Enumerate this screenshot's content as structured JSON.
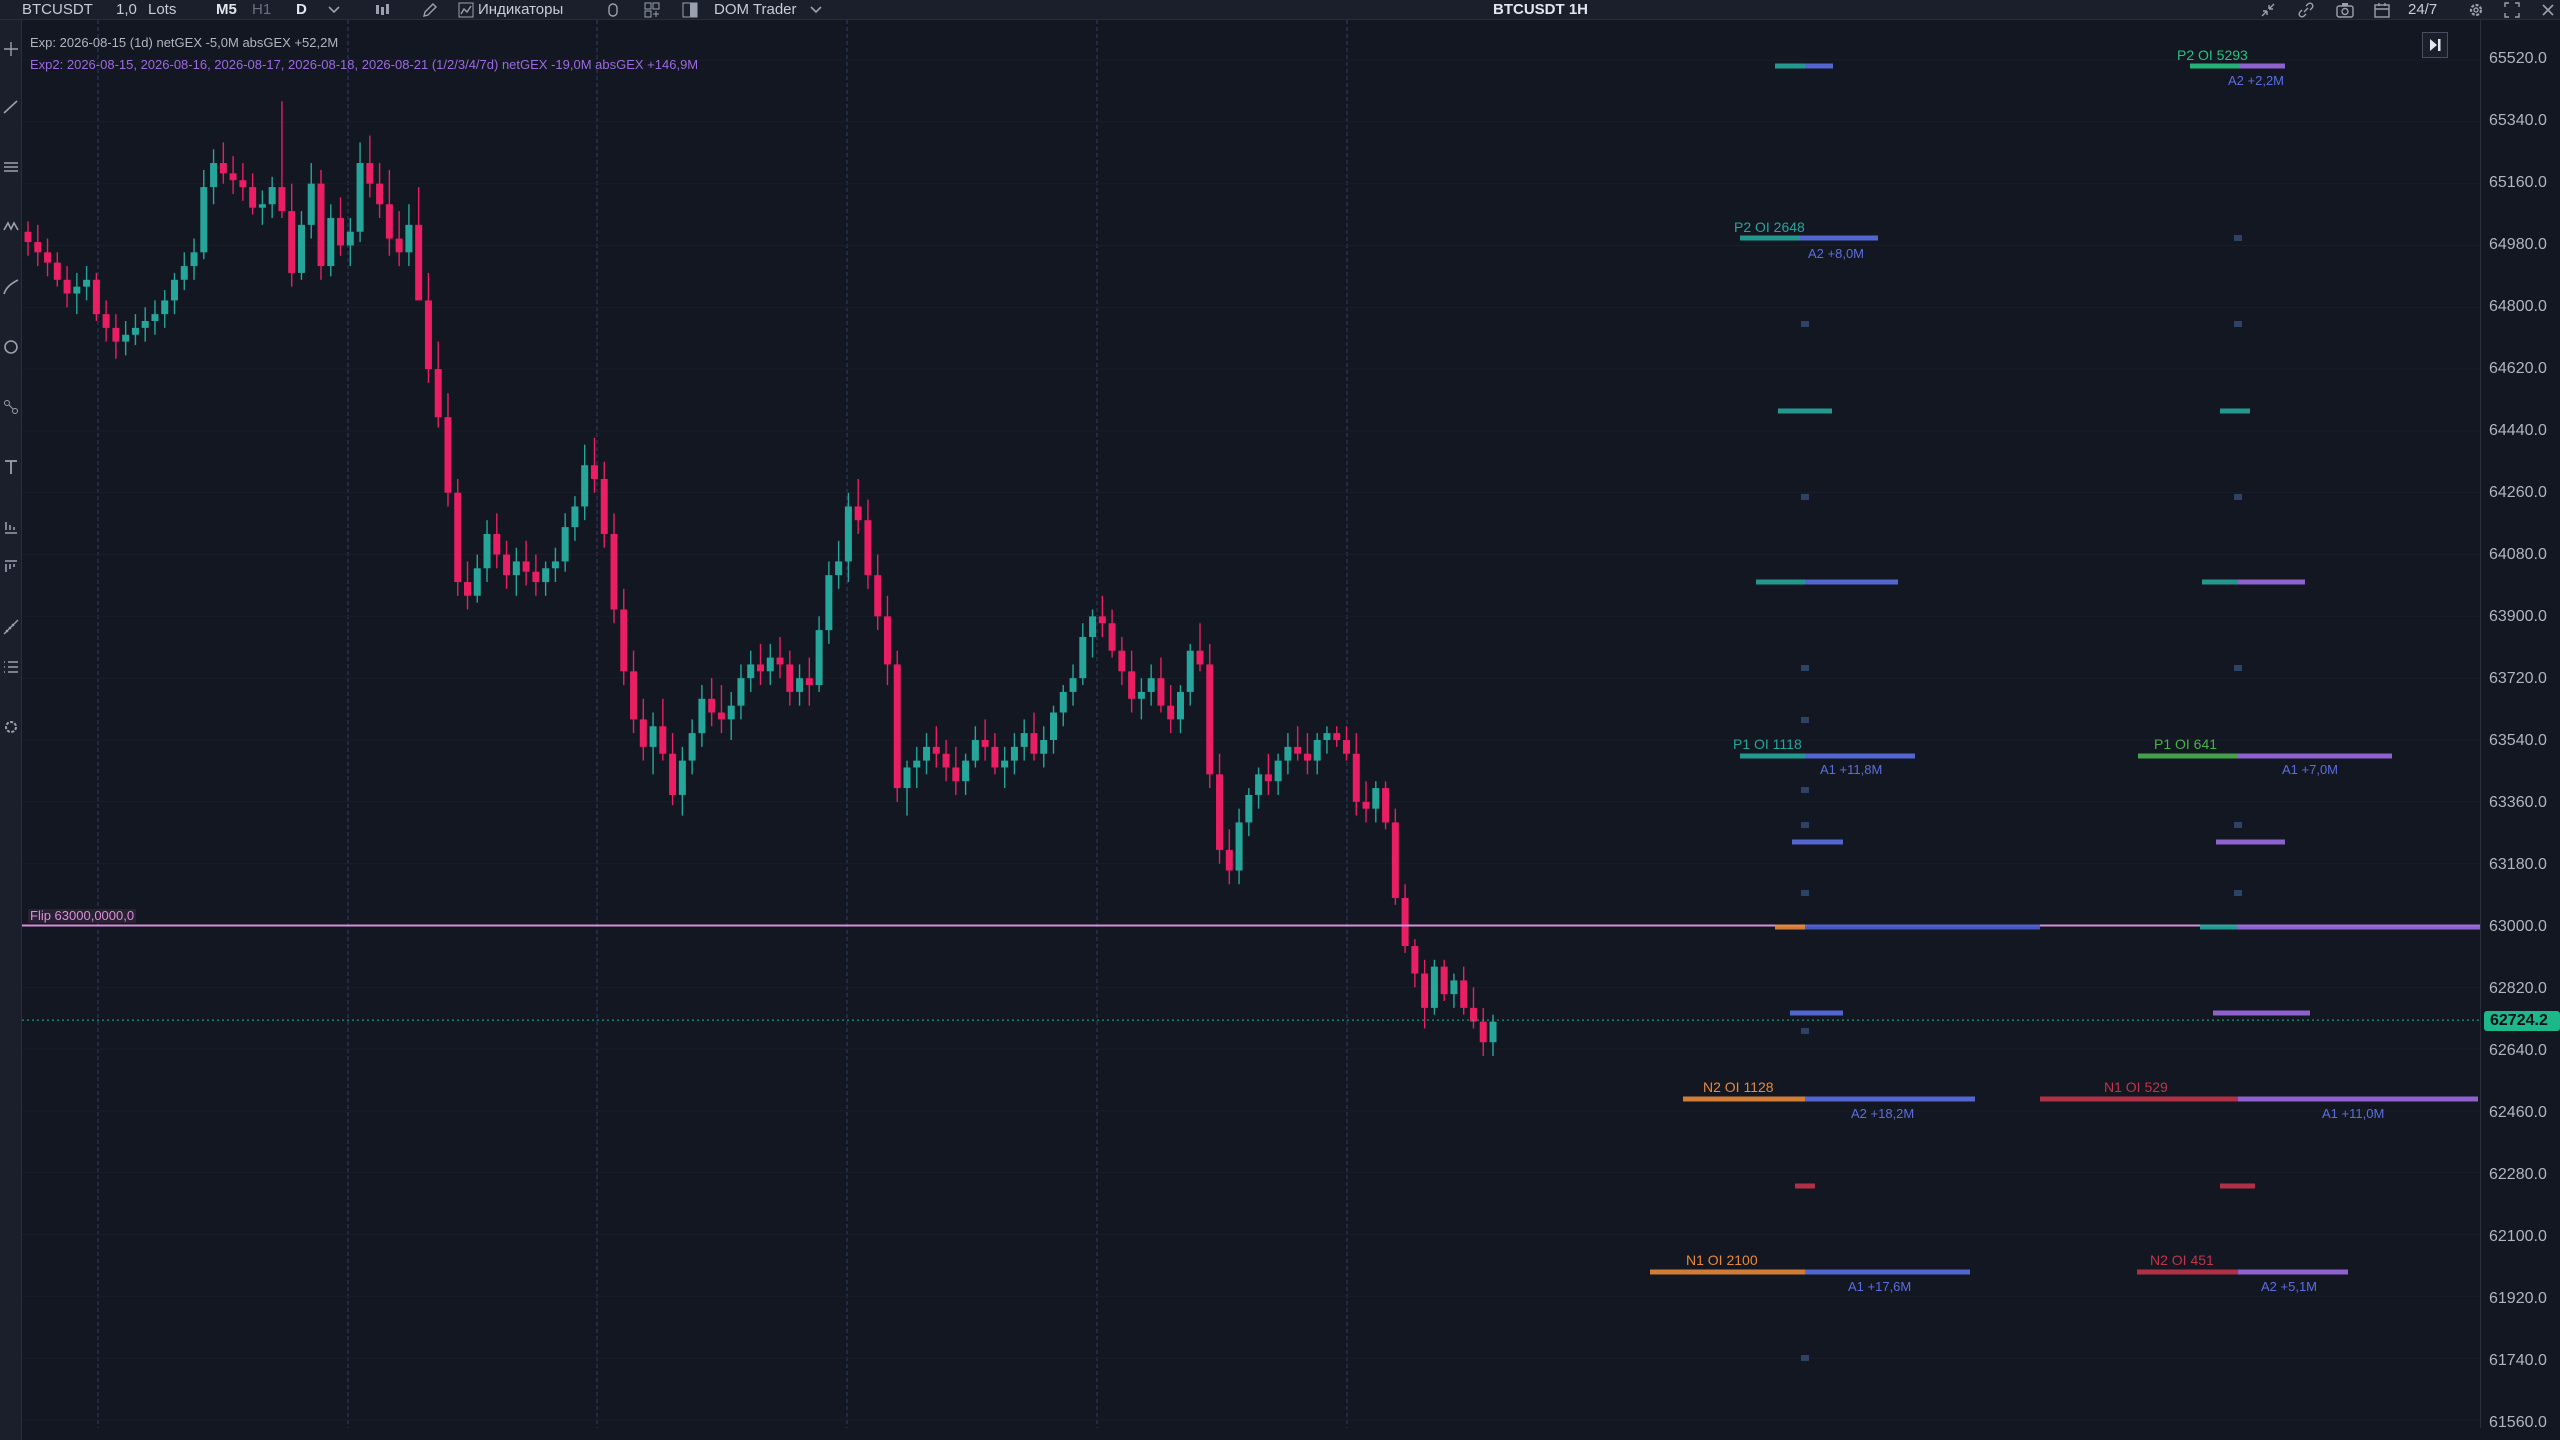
{
  "toolbar": {
    "symbol": "BTCUSDT",
    "quantity": "1,0",
    "quantity_unit": "Lots",
    "timeframes": [
      "M5",
      "H1",
      "D"
    ],
    "indicators_label": "Индикаторы",
    "dom_trader_label": "DOM Trader",
    "chart_title": "BTCUSDT 1H",
    "session_label": "24/7"
  },
  "overlay": {
    "exp1": "Exp: 2026-08-15 (1d)   netGEX -5,0M   absGEX +52,2M",
    "exp2": "Exp2: 2026-08-15, 2026-08-16, 2026-08-17, 2026-08-18, 2026-08-21 (1/2/3/4/7d)   netGEX -19,0M   absGEX +146,9M",
    "flip_label": "Flip 63000,0000,0"
  },
  "price_scale": {
    "labels": [
      "65520.0",
      "65340.0",
      "65160.0",
      "64980.0",
      "64800.0",
      "64620.0",
      "64440.0",
      "64260.0",
      "64080.0",
      "63900.0",
      "63720.0",
      "63540.0",
      "63360.0",
      "63180.0",
      "63000.0",
      "62820.0",
      "62640.0",
      "62460.0",
      "62280.0",
      "62100.0",
      "61920.0",
      "61740.0",
      "61560.0"
    ],
    "current_price": "62724.2"
  },
  "levels": [
    {
      "label": "P2  OI 5293",
      "sub": "A2  +2,2M",
      "color": "#26c281"
    },
    {
      "label": "P2  OI 2648",
      "sub": "A2  +8,0M",
      "color": "#26a69a"
    },
    {
      "label": "P1  OI 1118",
      "sub": "A1  +11,8M",
      "color": "#26a69a"
    },
    {
      "label": "P1  OI 641",
      "sub": "A1  +7,0M",
      "color": "#4caf50"
    },
    {
      "label": "N2  OI 1128",
      "sub": "A2  +18,2M",
      "color": "#e8883a"
    },
    {
      "label": "N1  OI 529",
      "sub": "A1  +11,0M",
      "color": "#c2344a"
    },
    {
      "label": "N1  OI 2100",
      "sub": "A1  +17,6M",
      "color": "#e8883a"
    },
    {
      "label": "N2  OI 451",
      "sub": "A2  +5,1M",
      "color": "#c2344a"
    }
  ],
  "colors": {
    "background": "#131722",
    "up_candle": "#26a69a",
    "down_candle": "#e91e63",
    "flip_line": "#d88fd8",
    "ask_bar": "#5b6ee1",
    "current_price_bg": "#1cb88a"
  },
  "candles": [
    [
      65020,
      65050,
      64950,
      64990
    ],
    [
      64990,
      65040,
      64920,
      64960
    ],
    [
      64960,
      65000,
      64890,
      64930
    ],
    [
      64930,
      64960,
      64860,
      64880
    ],
    [
      64880,
      64920,
      64800,
      64840
    ],
    [
      64840,
      64900,
      64780,
      64860
    ],
    [
      64860,
      64920,
      64820,
      64880
    ],
    [
      64880,
      64900,
      64760,
      64780
    ],
    [
      64780,
      64820,
      64700,
      64740
    ],
    [
      64740,
      64780,
      64650,
      64700
    ],
    [
      64700,
      64760,
      64660,
      64720
    ],
    [
      64720,
      64780,
      64690,
      64740
    ],
    [
      64740,
      64800,
      64700,
      64760
    ],
    [
      64760,
      64820,
      64720,
      64780
    ],
    [
      64780,
      64850,
      64740,
      64820
    ],
    [
      64820,
      64900,
      64780,
      64880
    ],
    [
      64880,
      64960,
      64850,
      64920
    ],
    [
      64920,
      65000,
      64880,
      64960
    ],
    [
      64960,
      65200,
      64940,
      65150
    ],
    [
      65150,
      65260,
      65100,
      65220
    ],
    [
      65220,
      65280,
      65160,
      65190
    ],
    [
      65190,
      65240,
      65130,
      65170
    ],
    [
      65170,
      65220,
      65110,
      65150
    ],
    [
      65150,
      65190,
      65070,
      65090
    ],
    [
      65090,
      65140,
      65040,
      65100
    ],
    [
      65100,
      65180,
      65060,
      65150
    ],
    [
      65150,
      65400,
      65060,
      65080
    ],
    [
      65080,
      65160,
      64860,
      64900
    ],
    [
      64900,
      65080,
      64880,
      65040
    ],
    [
      65040,
      65220,
      65000,
      65160
    ],
    [
      65160,
      65200,
      64880,
      64920
    ],
    [
      64920,
      65100,
      64890,
      65060
    ],
    [
      65060,
      65120,
      64950,
      64980
    ],
    [
      64980,
      65060,
      64920,
      65020
    ],
    [
      65020,
      65280,
      64990,
      65220
    ],
    [
      65220,
      65300,
      65120,
      65160
    ],
    [
      65160,
      65220,
      65060,
      65100
    ],
    [
      65100,
      65200,
      64950,
      65000
    ],
    [
      65000,
      65080,
      64920,
      64960
    ],
    [
      64960,
      65100,
      64920,
      65040
    ],
    [
      65040,
      65150,
      64880,
      64820
    ],
    [
      64820,
      64900,
      64580,
      64620
    ],
    [
      64620,
      64700,
      64450,
      64480
    ],
    [
      64480,
      64550,
      64220,
      64260
    ],
    [
      64260,
      64300,
      63960,
      64000
    ],
    [
      64000,
      64060,
      63920,
      63960
    ],
    [
      63960,
      64080,
      63940,
      64040
    ],
    [
      64040,
      64180,
      64000,
      64140
    ],
    [
      64140,
      64200,
      64040,
      64080
    ],
    [
      64080,
      64120,
      63980,
      64020
    ],
    [
      64020,
      64100,
      63960,
      64060
    ],
    [
      64060,
      64120,
      63990,
      64030
    ],
    [
      64030,
      64080,
      63960,
      64000
    ],
    [
      64000,
      64060,
      63960,
      64040
    ],
    [
      64040,
      64100,
      64000,
      64060
    ],
    [
      64060,
      64200,
      64030,
      64160
    ],
    [
      64160,
      64250,
      64120,
      64220
    ],
    [
      64220,
      64400,
      64180,
      64340
    ],
    [
      64340,
      64420,
      64260,
      64300
    ],
    [
      64300,
      64350,
      64100,
      64140
    ],
    [
      64140,
      64200,
      63880,
      63920
    ],
    [
      63920,
      63980,
      63700,
      63740
    ],
    [
      63740,
      63800,
      63560,
      63600
    ],
    [
      63600,
      63660,
      63480,
      63520
    ],
    [
      63520,
      63620,
      63440,
      63580
    ],
    [
      63580,
      63660,
      63480,
      63500
    ],
    [
      63500,
      63560,
      63350,
      63380
    ],
    [
      63380,
      63520,
      63320,
      63480
    ],
    [
      63480,
      63600,
      63440,
      63560
    ],
    [
      63560,
      63700,
      63520,
      63660
    ],
    [
      63660,
      63720,
      63580,
      63620
    ],
    [
      63620,
      63700,
      63560,
      63600
    ],
    [
      63600,
      63680,
      63540,
      63640
    ],
    [
      63640,
      63760,
      63600,
      63720
    ],
    [
      63720,
      63800,
      63680,
      63760
    ],
    [
      63760,
      63820,
      63700,
      63740
    ],
    [
      63740,
      63820,
      63700,
      63780
    ],
    [
      63780,
      63840,
      63720,
      63760
    ],
    [
      63760,
      63800,
      63640,
      63680
    ],
    [
      63680,
      63760,
      63640,
      63720
    ],
    [
      63720,
      63780,
      63640,
      63700
    ],
    [
      63700,
      63900,
      63680,
      63860
    ],
    [
      63860,
      64060,
      63820,
      64020
    ],
    [
      64020,
      64120,
      63980,
      64060
    ],
    [
      64060,
      64260,
      64000,
      64220
    ],
    [
      64220,
      64300,
      64140,
      64180
    ],
    [
      64180,
      64240,
      63980,
      64020
    ],
    [
      64020,
      64080,
      63860,
      63900
    ],
    [
      63900,
      63960,
      63700,
      63760
    ],
    [
      63760,
      63800,
      63360,
      63400
    ],
    [
      63400,
      63480,
      63320,
      63460
    ],
    [
      63460,
      63520,
      63400,
      63480
    ],
    [
      63480,
      63560,
      63440,
      63520
    ],
    [
      63520,
      63580,
      63460,
      63500
    ],
    [
      63500,
      63540,
      63420,
      63460
    ],
    [
      63460,
      63520,
      63380,
      63420
    ],
    [
      63420,
      63500,
      63380,
      63480
    ],
    [
      63480,
      63580,
      63460,
      63540
    ],
    [
      63540,
      63600,
      63480,
      63520
    ],
    [
      63520,
      63560,
      63440,
      63460
    ],
    [
      63460,
      63520,
      63400,
      63480
    ],
    [
      63480,
      63560,
      63440,
      63520
    ],
    [
      63520,
      63600,
      63480,
      63560
    ],
    [
      63560,
      63620,
      63480,
      63500
    ],
    [
      63500,
      63580,
      63460,
      63540
    ],
    [
      63540,
      63640,
      63500,
      63620
    ],
    [
      63620,
      63700,
      63580,
      63680
    ],
    [
      63680,
      63760,
      63640,
      63720
    ],
    [
      63720,
      63880,
      63700,
      63840
    ],
    [
      63840,
      63920,
      63780,
      63900
    ],
    [
      63900,
      63960,
      63840,
      63880
    ],
    [
      63880,
      63920,
      63780,
      63800
    ],
    [
      63800,
      63840,
      63700,
      63740
    ],
    [
      63740,
      63800,
      63620,
      63660
    ],
    [
      63660,
      63720,
      63600,
      63680
    ],
    [
      63680,
      63760,
      63640,
      63720
    ],
    [
      63720,
      63780,
      63620,
      63640
    ],
    [
      63640,
      63700,
      63560,
      63600
    ],
    [
      63600,
      63700,
      63560,
      63680
    ],
    [
      63680,
      63820,
      63640,
      63800
    ],
    [
      63800,
      63880,
      63740,
      63760
    ],
    [
      63760,
      63820,
      63400,
      63440
    ],
    [
      63440,
      63500,
      63180,
      63220
    ],
    [
      63220,
      63280,
      63120,
      63160
    ],
    [
      63160,
      63340,
      63120,
      63300
    ],
    [
      63300,
      63400,
      63260,
      63380
    ],
    [
      63380,
      63460,
      63340,
      63440
    ],
    [
      63440,
      63500,
      63380,
      63420
    ],
    [
      63420,
      63500,
      63380,
      63480
    ],
    [
      63480,
      63560,
      63440,
      63520
    ],
    [
      63520,
      63580,
      63480,
      63500
    ],
    [
      63500,
      63560,
      63440,
      63480
    ],
    [
      63480,
      63560,
      63440,
      63540
    ],
    [
      63540,
      63580,
      63500,
      63560
    ],
    [
      63560,
      63580,
      63520,
      63540
    ],
    [
      63540,
      63580,
      63480,
      63500
    ],
    [
      63500,
      63560,
      63320,
      63360
    ],
    [
      63360,
      63420,
      63300,
      63340
    ],
    [
      63340,
      63420,
      63300,
      63400
    ],
    [
      63400,
      63420,
      63280,
      63300
    ],
    [
      63300,
      63340,
      63060,
      63080
    ],
    [
      63080,
      63120,
      62920,
      62940
    ],
    [
      62940,
      62960,
      62820,
      62860
    ],
    [
      62860,
      62900,
      62700,
      62760
    ],
    [
      62760,
      62900,
      62740,
      62880
    ],
    [
      62880,
      62900,
      62780,
      62800
    ],
    [
      62800,
      62860,
      62760,
      62840
    ],
    [
      62840,
      62880,
      62740,
      62760
    ],
    [
      62760,
      62820,
      62700,
      62720
    ],
    [
      62720,
      62760,
      62620,
      62660
    ],
    [
      62660,
      62740,
      62620,
      62720
    ]
  ]
}
